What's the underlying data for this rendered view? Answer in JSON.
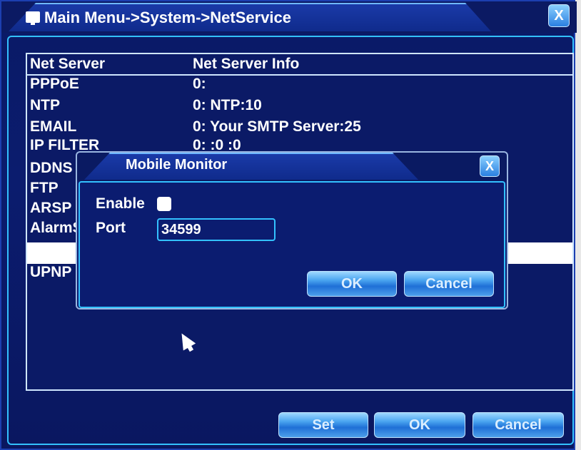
{
  "window": {
    "title": "Main Menu->System->NetService",
    "close_label": "X"
  },
  "table": {
    "headers": [
      "Net Server",
      "Net Server Info"
    ],
    "rows": [
      {
        "name": "PPPoE",
        "info": "0:"
      },
      {
        "name": "NTP",
        "info": "0: NTP:10"
      },
      {
        "name": "EMAIL",
        "info": "0: Your SMTP Server:25"
      },
      {
        "name": "IP FILTER",
        "info": "0: :0 :0"
      },
      {
        "name": "DDNS",
        "info": ""
      },
      {
        "name": "FTP",
        "info": ""
      },
      {
        "name": "ARSP",
        "info": ""
      },
      {
        "name": "AlarmServer",
        "info": ""
      },
      {
        "name": "",
        "info": ""
      },
      {
        "name": "UPNP",
        "info": ""
      }
    ]
  },
  "buttons": {
    "set": "Set",
    "ok": "OK",
    "cancel": "Cancel"
  },
  "dialog": {
    "title": "Mobile Monitor",
    "close_label": "X",
    "enable_label": "Enable",
    "enable_checked": false,
    "port_label": "Port",
    "port_value": "34599",
    "ok": "OK",
    "cancel": "Cancel"
  }
}
